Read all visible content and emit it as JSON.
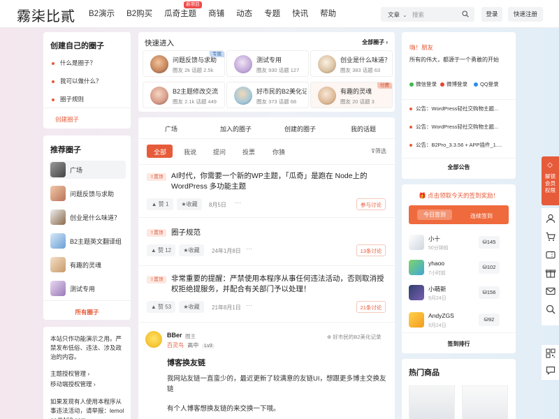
{
  "logo": "霧柒比貳",
  "nav": [
    {
      "label": "B2演示"
    },
    {
      "label": "B2购买"
    },
    {
      "label": "瓜奇主题",
      "badge": "新项目"
    },
    {
      "label": "商铺"
    },
    {
      "label": "动态"
    },
    {
      "label": "专题"
    },
    {
      "label": "快讯"
    },
    {
      "label": "帮助"
    }
  ],
  "search": {
    "type": "文章",
    "placeholder": "搜索"
  },
  "header_buttons": {
    "login": "登录",
    "register": "快速注册"
  },
  "left": {
    "create_title": "创建自己的圈子",
    "menu": [
      "什么是圈子？",
      "我可以做什么？",
      "圈子规则"
    ],
    "create_link": "创建圈子",
    "recommend_title": "推荐圈子",
    "recommend": [
      "广场",
      "问题反馈与求助",
      "创业是什么味道？",
      "B2主题英文翻译组",
      "有趣的灵魂",
      "测试专用"
    ],
    "all_circles": "所有圈子",
    "notice_text": "本站只作功能演示之用。严禁发布低俗、违法、涉及政治的内容。",
    "links": [
      "主题授权管理",
      "移动端授权管理"
    ],
    "report_text": "如果发现有人使用本程序从事违法活动，请举报：lemolee@163.com"
  },
  "quick": {
    "title": "快速进入",
    "all": "全部圈子",
    "items": [
      {
        "name": "问题反馈与求助",
        "stats": "圈友 2k 话题 2.5k",
        "tag": "专属"
      },
      {
        "name": "测试专用",
        "stats": "圈友 930 话题 127",
        "tag": ""
      },
      {
        "name": "创业是什么味道？",
        "stats": "圈友 383 话题 63",
        "tag": ""
      },
      {
        "name": "B2主题修改交流",
        "stats": "圈友 2.1k 话题 449",
        "tag": ""
      },
      {
        "name": "好市民的B2美化记录",
        "stats": "圈友 373 话题 68",
        "tag": ""
      },
      {
        "name": "有趣的灵魂",
        "stats": "圈友 20 话题 3",
        "tag": "付费"
      }
    ]
  },
  "tabs": [
    "广场",
    "加入的圈子",
    "创建的圈子",
    "我的话题"
  ],
  "subtabs": [
    "全部",
    "我说",
    "提问",
    "投票",
    "你猜"
  ],
  "filter": "筛选",
  "pin_label": "置顶",
  "posts": [
    {
      "title": "AI时代，你需要一个新的WP主题，「瓜奇」是跑在 Node上的 WordPress 多功能主题",
      "likes": "赞 1",
      "fav": "收藏",
      "date": "8月5日",
      "discuss": "参与讨论"
    },
    {
      "title": "圈子规范",
      "likes": "赞 12",
      "fav": "收藏",
      "date": "24年1月8日",
      "discuss": "13条讨论"
    },
    {
      "title": "非常重要的提醒：严禁使用本程序从事任何违法活动，否则取消授权拒绝提服务，并配合有关部门予以处理！",
      "likes": "赞 53",
      "fav": "收藏",
      "date": "21年8月1日",
      "discuss": "21条讨论"
    }
  ],
  "feed": {
    "author": "BBer",
    "role": "圈主",
    "group": "百灵鸟",
    "school": "高中",
    "level": "Lv3",
    "source": "好市民的B2美化记录",
    "title": "博客换友链",
    "body1": "我网站友链一直蛮少的，最近更新了较满意的友链UI，想跟更多博主交换友链",
    "body2": "有个人博客想换友链的来交换一下哦。"
  },
  "right": {
    "greet": "嗨！朋友",
    "motto": "所有的伟大，都源于一个勇敢的开始",
    "logins": [
      "微信登录",
      "微博登录",
      "QQ登录"
    ],
    "notices": [
      "公告：WordPress轻社交购物主题...",
      "公告：WordPress轻社交购物主题...",
      "公告：B2Pro_3.3.56 + APP插件_1...."
    ],
    "all_notice": "全部公告",
    "sign_title": "点击领取今天的签到奖励！",
    "today_sign": "今日签到",
    "continuous": "连续签到",
    "ranking": [
      {
        "name": "小十",
        "time": "50分钟前",
        "score": "145"
      },
      {
        "name": "yhaoo",
        "time": "7小时前",
        "score": "102"
      },
      {
        "name": "小萌新",
        "time": "9月24日",
        "score": "156"
      },
      {
        "name": "AndyZGS",
        "time": "9月24日",
        "score": "92"
      }
    ],
    "rank_link": "签到排行",
    "hot_title": "热门商品"
  },
  "side_promo": "解锁会员权限",
  "colors": {
    "accent": "#e65b3a",
    "sign_bg": "#ef6a3c"
  }
}
